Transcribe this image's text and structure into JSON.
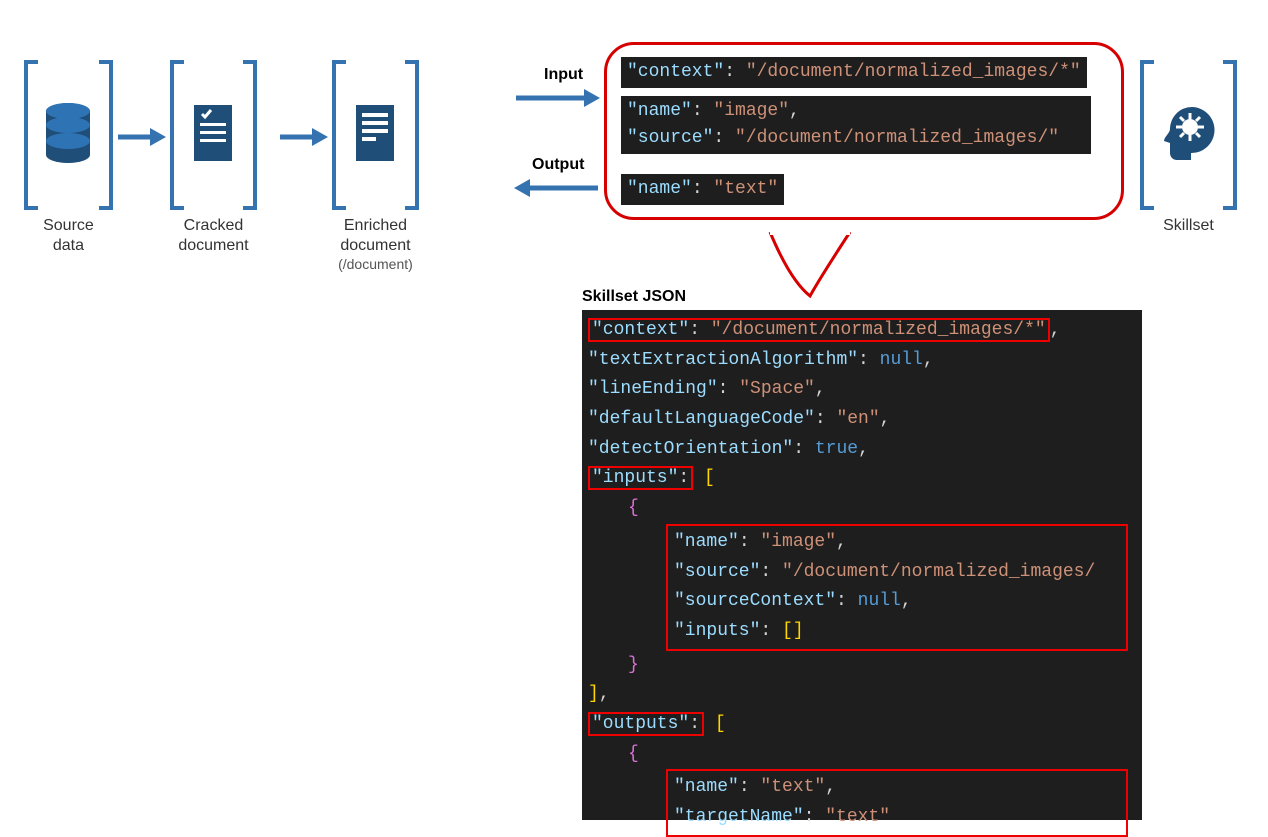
{
  "stages": {
    "source": {
      "label_l1": "Source",
      "label_l2": "data"
    },
    "cracked": {
      "label_l1": "Cracked",
      "label_l2": "document"
    },
    "enriched": {
      "label_l1": "Enriched",
      "label_l2": "document",
      "path": "(/document)"
    },
    "skillset": {
      "label": "Skillset"
    }
  },
  "io": {
    "input_label": "Input",
    "output_label": "Output"
  },
  "callout": {
    "line1": "\"context\": \"/document/normalized_images/*\"",
    "line2a": "\"name\": \"image\",",
    "line2b": "\"source\": \"/document/normalized_images/\"",
    "line3": "\"name\": \"text\""
  },
  "json_title": "Skillset JSON",
  "json": {
    "context_key": "\"context\"",
    "context_val": "\"/document/normalized_images/*\"",
    "textExtraction_key": "\"textExtractionAlgorithm\"",
    "textExtraction_val": "null",
    "lineEnding_key": "\"lineEnding\"",
    "lineEnding_val": "\"Space\"",
    "defaultLang_key": "\"defaultLanguageCode\"",
    "defaultLang_val": "\"en\"",
    "detectOrientation_key": "\"detectOrientation\"",
    "detectOrientation_val": "true",
    "inputs_key": "\"inputs\"",
    "inp_name_key": "\"name\"",
    "inp_name_val": "\"image\"",
    "inp_source_key": "\"source\"",
    "inp_source_val": "\"/document/normalized_images/",
    "inp_srcctx_key": "\"sourceContext\"",
    "inp_srcctx_val": "null",
    "inp_inputs_key": "\"inputs\"",
    "inp_inputs_val": "[]",
    "outputs_key": "\"outputs\"",
    "out_name_key": "\"name\"",
    "out_name_val": "\"text\"",
    "out_target_key": "\"targetName\"",
    "out_target_val": "\"text\""
  }
}
